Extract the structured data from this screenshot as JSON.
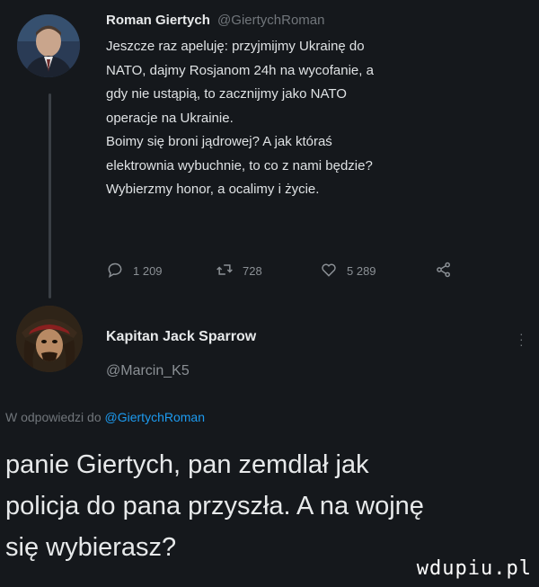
{
  "tweet": {
    "author_name": "Roman Giertych",
    "author_handle": "@GiertychRoman",
    "text_lines": [
      "Jeszcze raz apeluję: przyjmijmy Ukrainę do",
      "NATO, dajmy Rosjanom 24h na wycofanie, a",
      "gdy nie ustąpią, to zacznijmy jako NATO",
      "operacje na Ukrainie.",
      "Boimy się broni jądrowej? A jak któraś",
      "elektrownia wybuchnie, to co z nami będzie?",
      "Wybierzmy honor, a ocalimy i życie."
    ],
    "replies": "1 209",
    "retweets": "728",
    "likes": "5 289"
  },
  "reply": {
    "author_name": "Kapitan Jack Sparrow",
    "author_handle": "@Marcin_K5",
    "replying_to_prefix": "W odpowiedzi do",
    "replying_to_handle": "@GiertychRoman",
    "text_lines": [
      "panie Giertych, pan zemdlał jak",
      "policja do pana przyszła. A na wojnę",
      "się wybierasz?"
    ]
  },
  "watermark": "wdupiu.pl",
  "colors": {
    "background": "#15181c",
    "mention": "#1d9bf0",
    "muted": "#71767b"
  },
  "icons": [
    "reply-icon",
    "retweet-icon",
    "like-icon",
    "share-icon",
    "more-icon"
  ]
}
